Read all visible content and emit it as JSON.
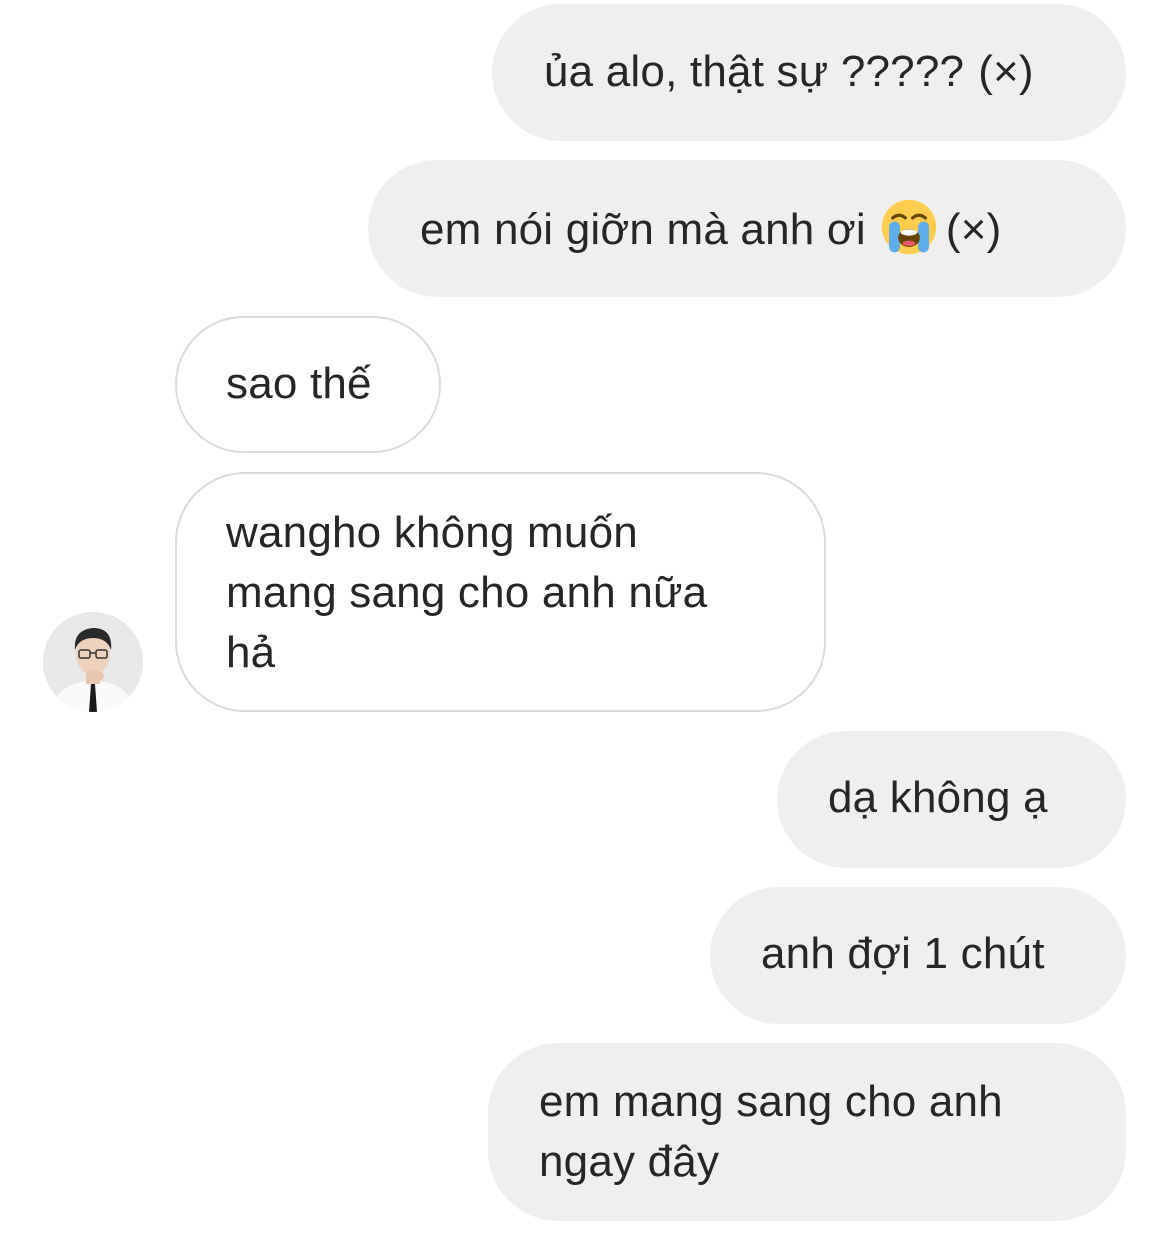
{
  "thread": {
    "avatar_icon": "user-avatar-photo",
    "messages": [
      {
        "side": "sent",
        "text": "ủa alo, thật sự ?????",
        "suffix": "(×)"
      },
      {
        "side": "sent",
        "text": "em nói giỡn mà anh ơi",
        "emoji": "loudly-crying-face",
        "suffix": "(×)"
      },
      {
        "side": "received",
        "text": "sao thế"
      },
      {
        "side": "received",
        "lines": [
          "wangho không muốn",
          "mang sang cho anh nữa",
          "hả"
        ]
      },
      {
        "side": "sent",
        "text": "dạ không ạ"
      },
      {
        "side": "sent",
        "text": "anh đợi 1 chút"
      },
      {
        "side": "sent",
        "lines": [
          "em mang sang cho anh",
          "ngay đây"
        ]
      }
    ]
  },
  "colors": {
    "sent_bubble": "#efefef",
    "received_border": "#dbdbdb",
    "text": "#262626"
  }
}
